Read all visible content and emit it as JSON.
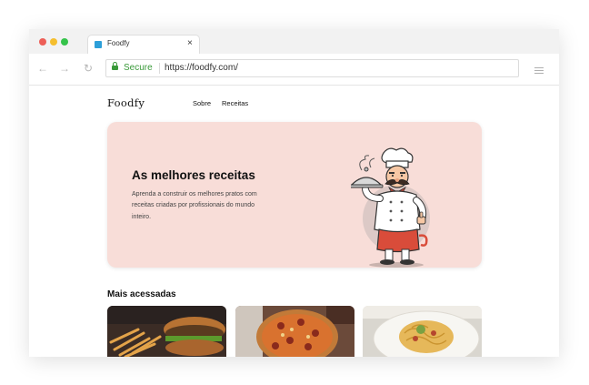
{
  "browser": {
    "tab_title": "Foodfy",
    "tab_close": "×",
    "secure_label": "Secure",
    "url": "https://foodfy.com/"
  },
  "site": {
    "logo": "Foodfy",
    "nav": [
      "Sobre",
      "Receitas"
    ]
  },
  "hero": {
    "title": "As melhores receitas",
    "description": "Aprenda a construir os melhores pratos com receitas criadas por profissionais do mundo inteiro."
  },
  "section": {
    "title": "Mais acessadas"
  },
  "cards": [
    {
      "image": "burger-fries-photo"
    },
    {
      "image": "pizza-photo"
    },
    {
      "image": "pasta-photo"
    }
  ],
  "colors": {
    "hero_background": "#f8ddd8",
    "secure_green": "#3a9a3a",
    "chef_apron_red": "#d94c3a"
  }
}
